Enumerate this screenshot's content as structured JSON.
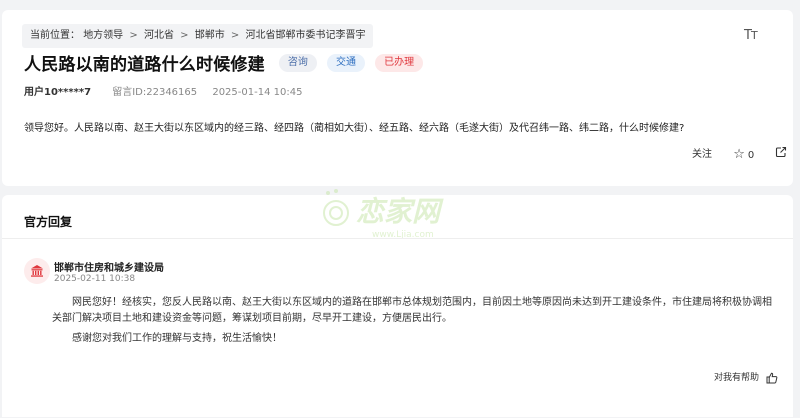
{
  "breadcrumb": {
    "prefix": "当前位置：",
    "items": [
      "地方领导",
      "河北省",
      "邯郸市",
      "河北省邯郸市委书记李晋宇"
    ],
    "separator": ">"
  },
  "font_tool": {
    "label_small": "T",
    "label_large": "T"
  },
  "question": {
    "title": "人民路以南的道路什么时候修建",
    "tags": [
      "咨询",
      "交通",
      "已办理"
    ],
    "user": "用户10*****7",
    "message_id": "留言ID:22346165",
    "date": "2025-01-14 10:45",
    "content": "领导您好。人民路以南、赵王大街以东区域内的经三路、经四路（蔺相如大街）、经五路、经六路（毛遂大街）及代召纬一路、纬二路，什么时候修建?"
  },
  "actions": {
    "follow": "关注",
    "like_count": "0"
  },
  "reply": {
    "section_title": "官方回复",
    "department": "邯郸市住房和城乡建设局",
    "time": "2025-02-11 10:38",
    "paragraph1": "网民您好！经核实，您反人民路以南、赵王大街以东区域内的道路在邯郸市总体规划范围内，目前因土地等原因尚未达到开工建设条件，市住建局将积极协调相关部门解决项目土地和建设资金等问题，筹谋划项目前期，尽早开工建设，方便居民出行。",
    "paragraph2": "感谢您对我们工作的理解与支持，祝生活愉快！",
    "helpful": "对我有帮助"
  },
  "watermark": {
    "text": "恋家网",
    "url": "www.Ljia.com"
  },
  "colors": {
    "page_bg": "#f2f3f5",
    "status_red": "#e0383e",
    "tag_blue": "#2f6fc0",
    "watermark_green": "#9bd46a"
  }
}
